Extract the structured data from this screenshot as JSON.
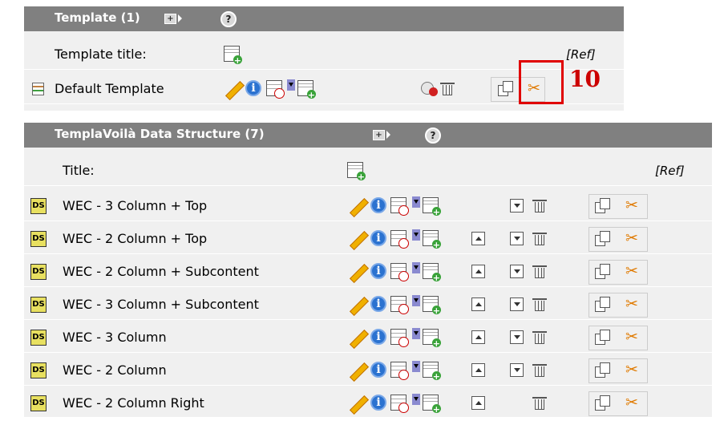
{
  "template_panel": {
    "header_title": "Template (1)",
    "expand_symbol": "+",
    "help_symbol": "?",
    "title_label": "Template title:",
    "ref_label": "[Ref]",
    "row": {
      "icon": "template-icon",
      "title": "Default Template"
    }
  },
  "annotation": {
    "number": "10",
    "color": "#e00000"
  },
  "ds_panel": {
    "header_title": "TemplaVoilà Data Structure (7)",
    "expand_symbol": "+",
    "help_symbol": "?",
    "title_label": "Title:",
    "ref_label": "[Ref]",
    "ds_icon_text": "DS",
    "rows": [
      {
        "title": "WEC - 3 Column + Top"
      },
      {
        "title": "WEC - 2 Column + Top"
      },
      {
        "title": "WEC - 2 Column + Subcontent"
      },
      {
        "title": "WEC - 3 Column + Subcontent"
      },
      {
        "title": "WEC - 3 Column"
      },
      {
        "title": "WEC - 2 Column"
      },
      {
        "title": "WEC - 2 Column Right"
      }
    ]
  },
  "icons": {
    "cut_glyph": "✂",
    "info_glyph": "i"
  },
  "colors": {
    "header_bg": "#808080",
    "panel_bg": "#f0f0f0",
    "accent_red": "#e00000"
  }
}
